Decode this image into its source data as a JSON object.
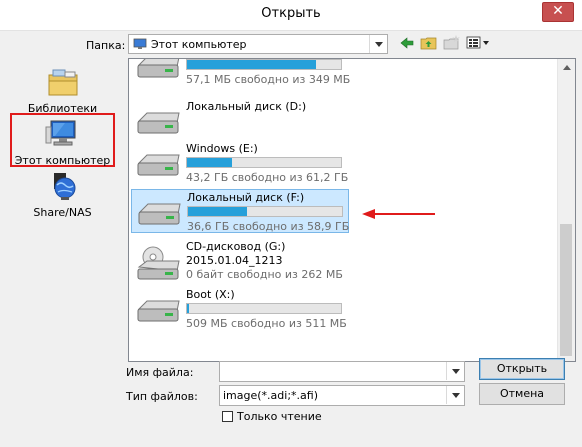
{
  "window": {
    "title": "Открыть",
    "close_symbol": "✕"
  },
  "lookin": {
    "label": "Папка:",
    "value": "Этот компьютер"
  },
  "places": [
    {
      "label": "Библиотеки",
      "icon": "libraries-icon"
    },
    {
      "label": "Этот компьютер",
      "icon": "computer-icon"
    },
    {
      "label": "Share/NAS",
      "icon": "network-globe-icon"
    }
  ],
  "drives": [
    {
      "name": "",
      "info": "57,1 МБ свободно из 349 МБ",
      "used_fraction": 0.84
    },
    {
      "name": "Локальный диск (D:)",
      "info": "",
      "used_fraction": null
    },
    {
      "name": "Windows (E:)",
      "info": "43,2 ГБ свободно из 61,2 ГБ",
      "used_fraction": 0.29
    },
    {
      "name": "Локальный диск (F:)",
      "info": "36,6 ГБ свободно из 58,9 ГБ",
      "used_fraction": 0.38
    },
    {
      "name": "CD-дисковод (G:)",
      "sub": "2015.01.04_1213",
      "info": "0 байт свободно из 262 МБ"
    },
    {
      "name": "Boot (X:)",
      "info": "509 МБ свободно из 511 МБ",
      "used_fraction": 0.004
    }
  ],
  "filename": {
    "label": "Имя файла:",
    "value": ""
  },
  "filetype": {
    "label": "Тип файлов:",
    "value": "image(*.adi;*.afi)"
  },
  "buttons": {
    "open": "Открыть",
    "cancel": "Отмена"
  },
  "readonly": {
    "label": "Только чтение",
    "checked": false
  },
  "colors": {
    "bar_fill": "#26a0da",
    "selection": "#cce8ff",
    "highlight_red": "#e01b1b"
  }
}
